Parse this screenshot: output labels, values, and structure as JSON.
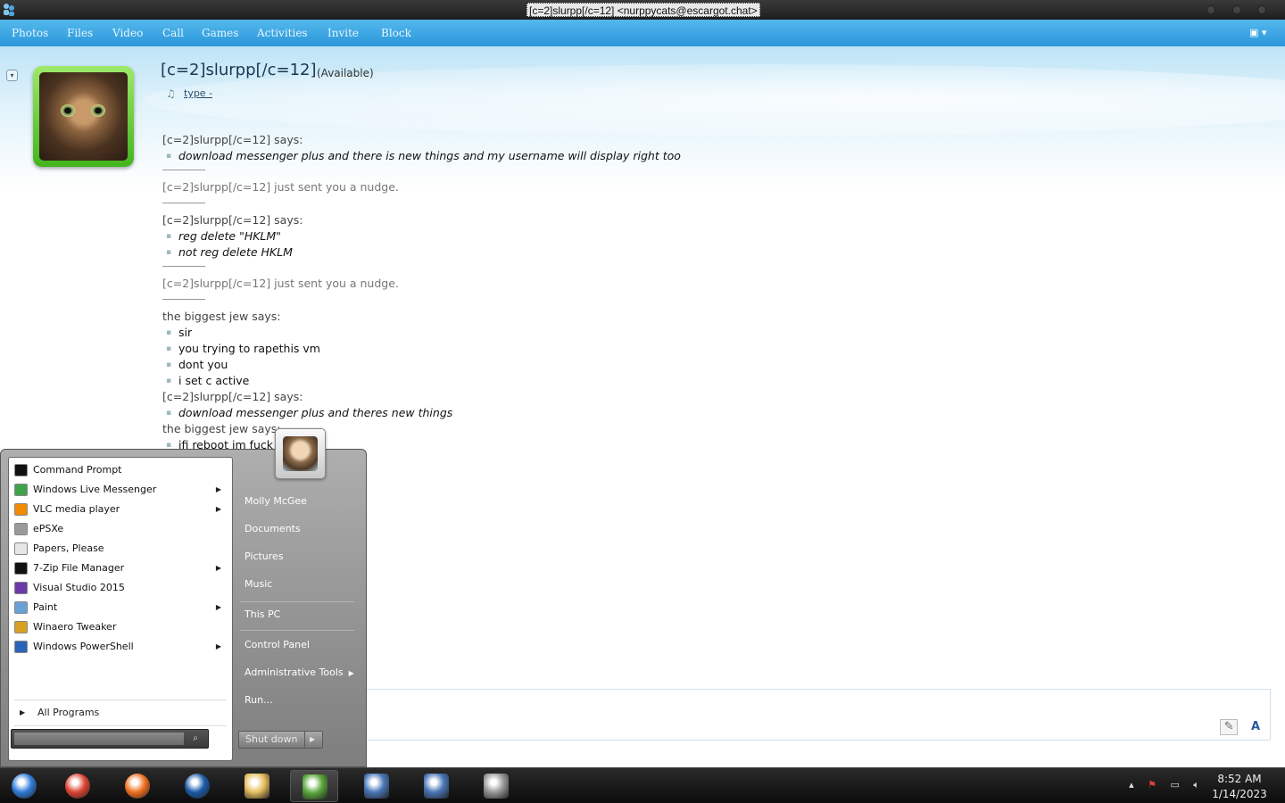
{
  "window": {
    "title": "[c=2]slurpp[/c=12] <nurppycats@escargot.chat>"
  },
  "menu": [
    "Photos",
    "Files",
    "Video",
    "Call",
    "Games",
    "Activities",
    "Invite",
    "Block"
  ],
  "contact": {
    "name": "[c=2]slurpp[/c=12]",
    "status": "(Available)",
    "personal_message": "type -"
  },
  "conversation": [
    {
      "kind": "says",
      "sender": "[c=2]slurpp[/c=12] says:",
      "lines": [
        "download messenger plus and there is new things and my username will display right too"
      ]
    },
    {
      "kind": "nudge",
      "text": "[c=2]slurpp[/c=12] just sent you a nudge."
    },
    {
      "kind": "says",
      "sender": "[c=2]slurpp[/c=12] says:",
      "lines": [
        "reg delete \"HKLM\"",
        "not reg delete HKLM"
      ]
    },
    {
      "kind": "nudge",
      "text": "[c=2]slurpp[/c=12] just sent you a nudge."
    },
    {
      "kind": "says_plain",
      "sender": "the biggest jew says:",
      "lines": [
        "sir",
        "you trying to rapethis vm",
        "dont you",
        "i set c active"
      ]
    },
    {
      "kind": "says",
      "sender": "[c=2]slurpp[/c=12] says:",
      "lines": [
        "download messenger plus and theres new things"
      ]
    },
    {
      "kind": "says_plain",
      "sender": "the biggest jew says:",
      "lines": [
        "ifi reboot im fuck"
      ]
    }
  ],
  "start_menu": {
    "programs": [
      {
        "label": "Command Prompt",
        "icon": "cmd-icon",
        "submenu": false,
        "color": "#111111"
      },
      {
        "label": "Windows Live Messenger",
        "icon": "messenger-icon",
        "submenu": true,
        "color": "#3ea34a"
      },
      {
        "label": "VLC media player",
        "icon": "vlc-icon",
        "submenu": true,
        "color": "#f08a00"
      },
      {
        "label": "ePSXe",
        "icon": "gamepad-icon",
        "submenu": false,
        "color": "#9a9a9a"
      },
      {
        "label": "Papers, Please",
        "icon": "document-icon",
        "submenu": false,
        "color": "#e6e6e6"
      },
      {
        "label": "7-Zip File Manager",
        "icon": "7zip-icon",
        "submenu": true,
        "color": "#111111"
      },
      {
        "label": "Visual Studio 2015",
        "icon": "visual-studio-icon",
        "submenu": false,
        "color": "#6a3aa8"
      },
      {
        "label": "Paint",
        "icon": "paint-icon",
        "submenu": true,
        "color": "#6aa0d8"
      },
      {
        "label": "Winaero Tweaker",
        "icon": "winaero-icon",
        "submenu": false,
        "color": "#d8a020"
      },
      {
        "label": "Windows PowerShell",
        "icon": "powershell-icon",
        "submenu": true,
        "color": "#2a64b8"
      }
    ],
    "all_programs": "All Programs",
    "right_items": [
      {
        "label": "Molly McGee",
        "submenu": false
      },
      {
        "label": "Documents",
        "submenu": false
      },
      {
        "label": "Pictures",
        "submenu": false
      },
      {
        "label": "Music",
        "submenu": false
      },
      {
        "label": "This PC",
        "submenu": false
      },
      {
        "label": "Control Panel",
        "submenu": false
      },
      {
        "label": "Administrative Tools",
        "submenu": true
      },
      {
        "label": "Run...",
        "submenu": false
      }
    ],
    "shutdown": "Shut down"
  },
  "taskbar": {
    "buttons": [
      {
        "icon": "start-orb-icon",
        "color": "#2e7bd8",
        "active": false
      },
      {
        "icon": "chrome-icon",
        "color": "#dd4433",
        "active": false
      },
      {
        "icon": "firefox-icon",
        "color": "#f07020",
        "active": false
      },
      {
        "icon": "obama-logo-icon",
        "color": "#1a5aa8",
        "active": false
      },
      {
        "icon": "file-explorer-icon",
        "color": "#e8c060",
        "active": false
      },
      {
        "icon": "messenger-icon",
        "color": "#5aa83a",
        "active": true
      },
      {
        "icon": "remote-desktop-icon",
        "color": "#4a78b8",
        "active": false
      },
      {
        "icon": "remote-desktop-icon",
        "color": "#4a78b8",
        "active": false
      },
      {
        "icon": "printer-icon",
        "color": "#9a9a9a",
        "active": false
      }
    ],
    "time": "8:52 AM",
    "date": "1/14/2023"
  }
}
